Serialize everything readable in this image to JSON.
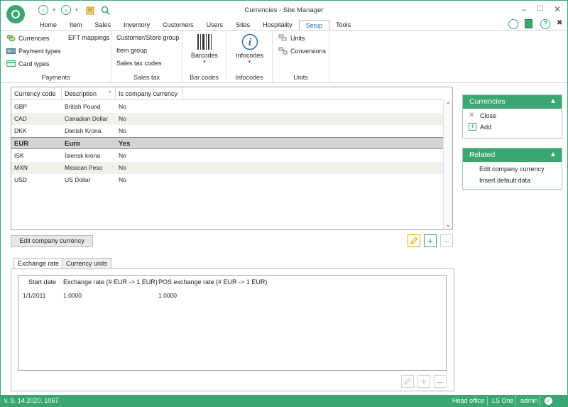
{
  "window": {
    "title": "Currencies - Site Manager"
  },
  "quick_access": [
    "back-icon",
    "dropdown-icon",
    "forward-icon",
    "dropdown-icon",
    "notepad-icon",
    "search-icon"
  ],
  "ribbon_tabs": [
    "Home",
    "Item",
    "Sales",
    "Inventory",
    "Customers",
    "Users",
    "Sites",
    "Hospitality",
    "Setup",
    "Tools"
  ],
  "active_tab": "Setup",
  "ribbon": {
    "payments": {
      "items": [
        "Currencies",
        "Payment types",
        "Card types"
      ],
      "eft": "EFT mappings",
      "label": "Payments"
    },
    "sales_tax": {
      "items": [
        "Customer/Store group",
        "Item group",
        "Sales tax codes"
      ],
      "label": "Sales tax"
    },
    "bar_codes": {
      "button": "Barcodes",
      "label": "Bar codes"
    },
    "infocodes": {
      "button": "Infocodes",
      "label": "Infocodes"
    },
    "units": {
      "items": [
        "Units",
        "Conversions"
      ],
      "label": "Units"
    }
  },
  "grid": {
    "columns": [
      "Currency code",
      "Description",
      "Is company currency"
    ],
    "rows": [
      [
        "GBP",
        "British Pound",
        "No"
      ],
      [
        "CAD",
        "Canadian Dollar",
        "No"
      ],
      [
        "DKK",
        "Danish Krona",
        "No"
      ],
      [
        "EUR",
        "Euro",
        "Yes"
      ],
      [
        "ISK",
        "Íslensk króna",
        "No"
      ],
      [
        "MXN",
        "Mexican Peso",
        "No"
      ],
      [
        "USD",
        "US Dollar",
        "No"
      ]
    ],
    "selected_row": 3
  },
  "buttons": {
    "edit_company_currency": "Edit company currency"
  },
  "lower_tabs": [
    "Exchange rate",
    "Currency units"
  ],
  "exchange": {
    "columns": [
      "Start date",
      "Exchange rate (# EUR -> 1 EUR)",
      "POS exchange rate (# EUR -> 1 EUR)"
    ],
    "rows": [
      [
        "1/1/2011",
        "1.0000",
        "1.0000"
      ]
    ]
  },
  "side_panels": {
    "currencies": {
      "title": "Currencies",
      "items": [
        "Close",
        "Add"
      ]
    },
    "related": {
      "title": "Related",
      "items": [
        "Edit company currency",
        "Insert default data"
      ]
    }
  },
  "status": {
    "version": "v. 9. 14.2020. 1057",
    "site": "Head office",
    "product": "LS One",
    "user": "admin"
  },
  "colors": {
    "accent": "#3aa672",
    "active_tab_text": "#2a6fb3",
    "alt_row": "#eff2e9",
    "selected_row": "#d4d4d4"
  }
}
